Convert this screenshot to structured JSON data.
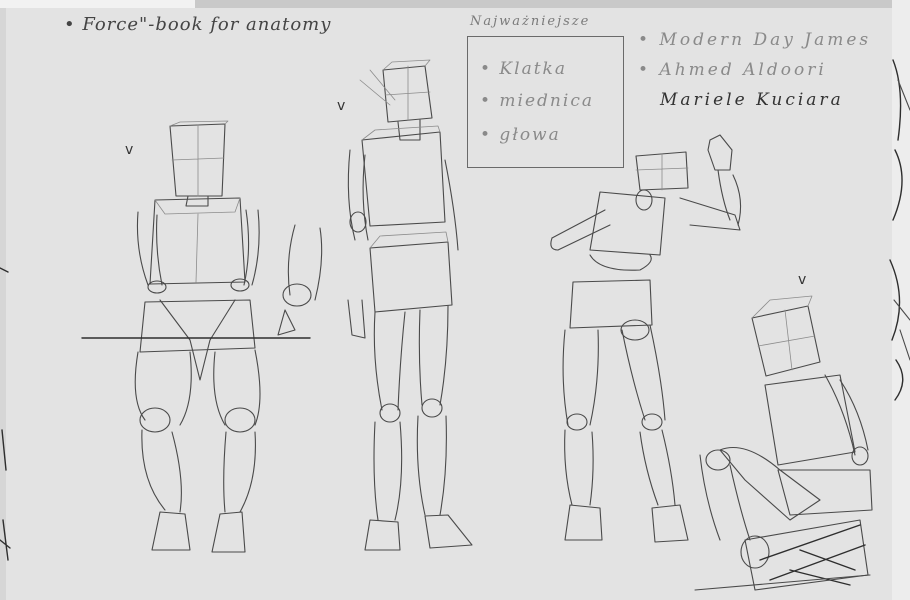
{
  "header_note": "• Force\"-book for anatomy",
  "important_box": {
    "title": "Najważniejsze",
    "items": [
      "• Klatka",
      "• miednica",
      "• głowa"
    ]
  },
  "artists": [
    "• Modern Day James",
    "• Ahmed Aldoori",
    "Mariele Kuciara"
  ],
  "check_mark": "v",
  "colors": {
    "background": "#d6d6d6",
    "sheet": "#e3e3e3",
    "stroke": "#4a4a4a",
    "light_text": "#8a8a8a"
  }
}
